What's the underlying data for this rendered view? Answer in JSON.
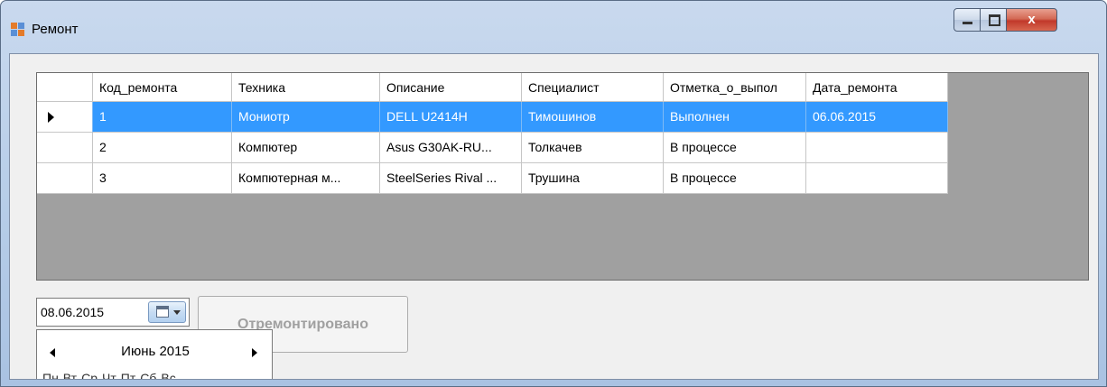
{
  "window": {
    "title": "Ремонт",
    "close_glyph": "x",
    "colors": {
      "frame": "#b9cfe9",
      "close": "#c1392b"
    }
  },
  "grid": {
    "columns": [
      "Код_ремонта",
      "Техника",
      "Описание",
      "Специалист",
      "Отметка_о_выпол",
      "Дата_ремонта"
    ],
    "rows": [
      [
        "1",
        "Мониотр",
        "DELL U2414H",
        "Тимошинов",
        "Выполнен",
        "06.06.2015"
      ],
      [
        "2",
        "Компютер",
        "Asus G30AK-RU...",
        "Толкачев",
        "В процессе",
        ""
      ],
      [
        "3",
        "Компютерная м...",
        "SteelSeries Rival ...",
        "Трушина",
        "В процессе",
        ""
      ]
    ],
    "selected_row": 0,
    "selection_color": "#3399ff"
  },
  "datepicker": {
    "value": "08.06.2015"
  },
  "repair_button": {
    "label": "Отремонтировано"
  },
  "calendar": {
    "month_label": "Июнь 2015",
    "weekdays": [
      "Пн",
      "Вт",
      "Ср",
      "Чт",
      "Пт",
      "Сб",
      "Вс"
    ]
  },
  "icons": {
    "app": "app-icon",
    "minimize": "minimize-icon",
    "maximize": "maximize-icon",
    "close": "close-icon",
    "row_pointer": "row-pointer-icon",
    "calendar": "calendar-icon",
    "dropdown": "chevron-down-icon",
    "prev": "chevron-left-icon",
    "next": "chevron-right-icon"
  }
}
